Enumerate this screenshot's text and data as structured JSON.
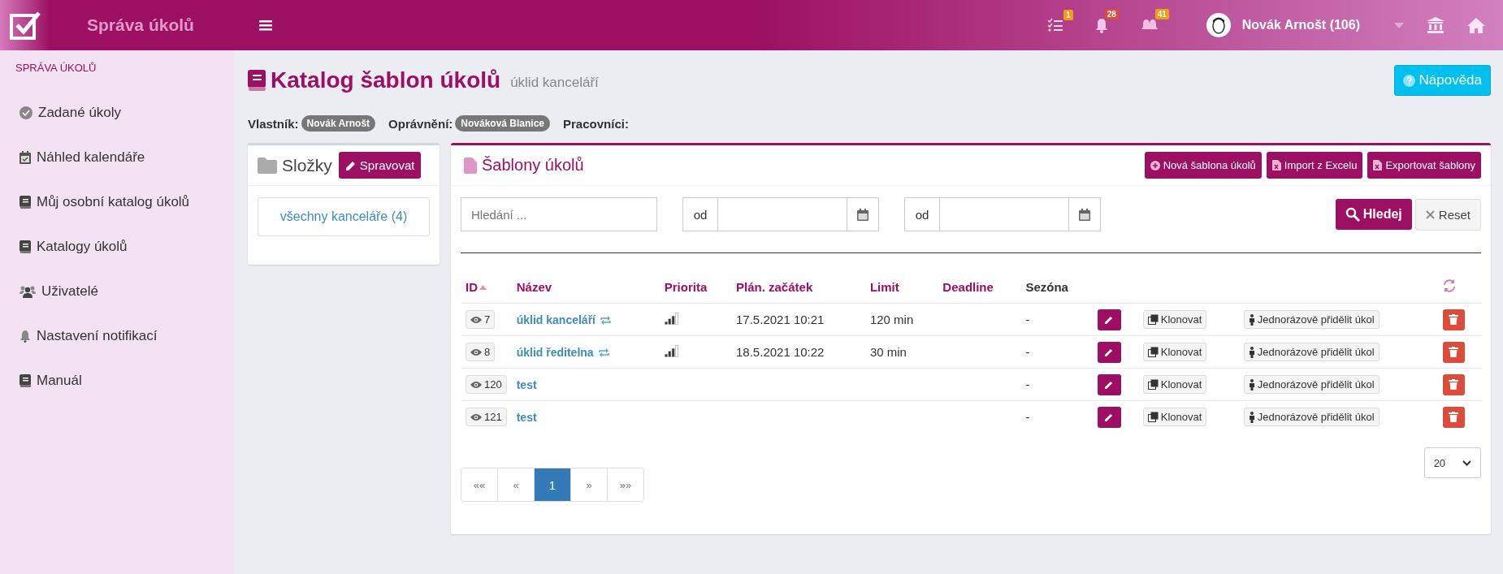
{
  "header": {
    "app_title": "Správa úkolů",
    "notifications": [
      {
        "kind": "tasks",
        "badge": "1",
        "color": "#f39c12"
      },
      {
        "kind": "bell",
        "badge": "28",
        "color": "#dd4b39"
      },
      {
        "kind": "bells",
        "badge": "41",
        "color": "#f39c12"
      }
    ],
    "user": "Novák Arnošt (106)"
  },
  "sidebar": {
    "heading": "SPRÁVA ÚKOLŮ",
    "items": [
      {
        "kind": "check",
        "label": "Zadané úkoly"
      },
      {
        "kind": "calendar",
        "label": "Náhled kalendáře"
      },
      {
        "kind": "book",
        "label": "Můj osobní katalog úkolů"
      },
      {
        "kind": "book",
        "label": "Katalogy úkolů"
      },
      {
        "kind": "users",
        "label": "Uživatelé"
      },
      {
        "kind": "bell",
        "label": "Nastavení notifikací"
      },
      {
        "kind": "book",
        "label": "Manuál"
      }
    ]
  },
  "page": {
    "title": "Katalog šablon úkolů",
    "subtitle": "úklid kanceláří",
    "help_button": "Nápověda"
  },
  "meta": [
    {
      "label": "Vlastník:",
      "value": "Novák Arnošt"
    },
    {
      "label": "Oprávnění:",
      "value": "Nováková Blanice"
    },
    {
      "label": "Pracovníci:"
    }
  ],
  "folders": {
    "title": "Složky",
    "manage_button": "Spravovat",
    "items": [
      "všechny kanceláře (4)"
    ]
  },
  "templates": {
    "title": "Šablony úkolů",
    "actions": [
      {
        "kind": "add",
        "label": "Nová šablona úkolů"
      },
      {
        "kind": "excel",
        "label": "Import z Excelu"
      },
      {
        "kind": "excel",
        "label": "Exportovat šablony"
      }
    ],
    "filters": {
      "search_placeholder": "Hledání ...",
      "date_ranges": [
        {
          "prefix": "od"
        },
        {
          "prefix": "od"
        }
      ],
      "search_button": "Hledej",
      "reset_button": "Reset"
    },
    "table": {
      "columns": [
        {
          "label": "ID",
          "sortable": true,
          "sorted": true
        },
        {
          "label": "Název",
          "sortable": true,
          "sorted": false
        },
        {
          "label": "Priorita",
          "sortable": true,
          "sorted": false
        },
        {
          "label": "Plán. začátek",
          "sortable": true,
          "sorted": false
        },
        {
          "label": "Limit",
          "sortable": true,
          "sorted": false
        },
        {
          "label": "Deadline",
          "sortable": true,
          "sorted": false
        },
        {
          "label": "Sezóna",
          "sortable": false,
          "sorted": false
        }
      ],
      "rows": [
        {
          "id": "7",
          "name": "úklid kanceláří",
          "recurring": true,
          "level": 0.75,
          "start": "17.5.2021 10:21",
          "limit": "120 min",
          "season": "-",
          "clone": "Klonovat",
          "assign": "Jednorázově přidělit úkol"
        },
        {
          "id": "8",
          "name": "úklid ředitelna",
          "recurring": true,
          "level": 0.75,
          "start": "18.5.2021 10:22",
          "limit": "30 min",
          "season": "-",
          "clone": "Klonovat",
          "assign": "Jednorázově přidělit úkol"
        },
        {
          "id": "120",
          "name": "test",
          "recurring": false,
          "season": "-",
          "clone": "Klonovat",
          "assign": "Jednorázově přidělit úkol"
        },
        {
          "id": "121",
          "name": "test",
          "recurring": false,
          "season": "-",
          "clone": "Klonovat",
          "assign": "Jednorázově přidělit úkol"
        }
      ]
    },
    "pagination": [
      {
        "label": "««",
        "selected": false
      },
      {
        "label": "«",
        "selected": false
      },
      {
        "label": "1",
        "selected": true
      },
      {
        "label": "»",
        "selected": false
      },
      {
        "label": "»»",
        "selected": false
      }
    ],
    "page_size": "20"
  }
}
